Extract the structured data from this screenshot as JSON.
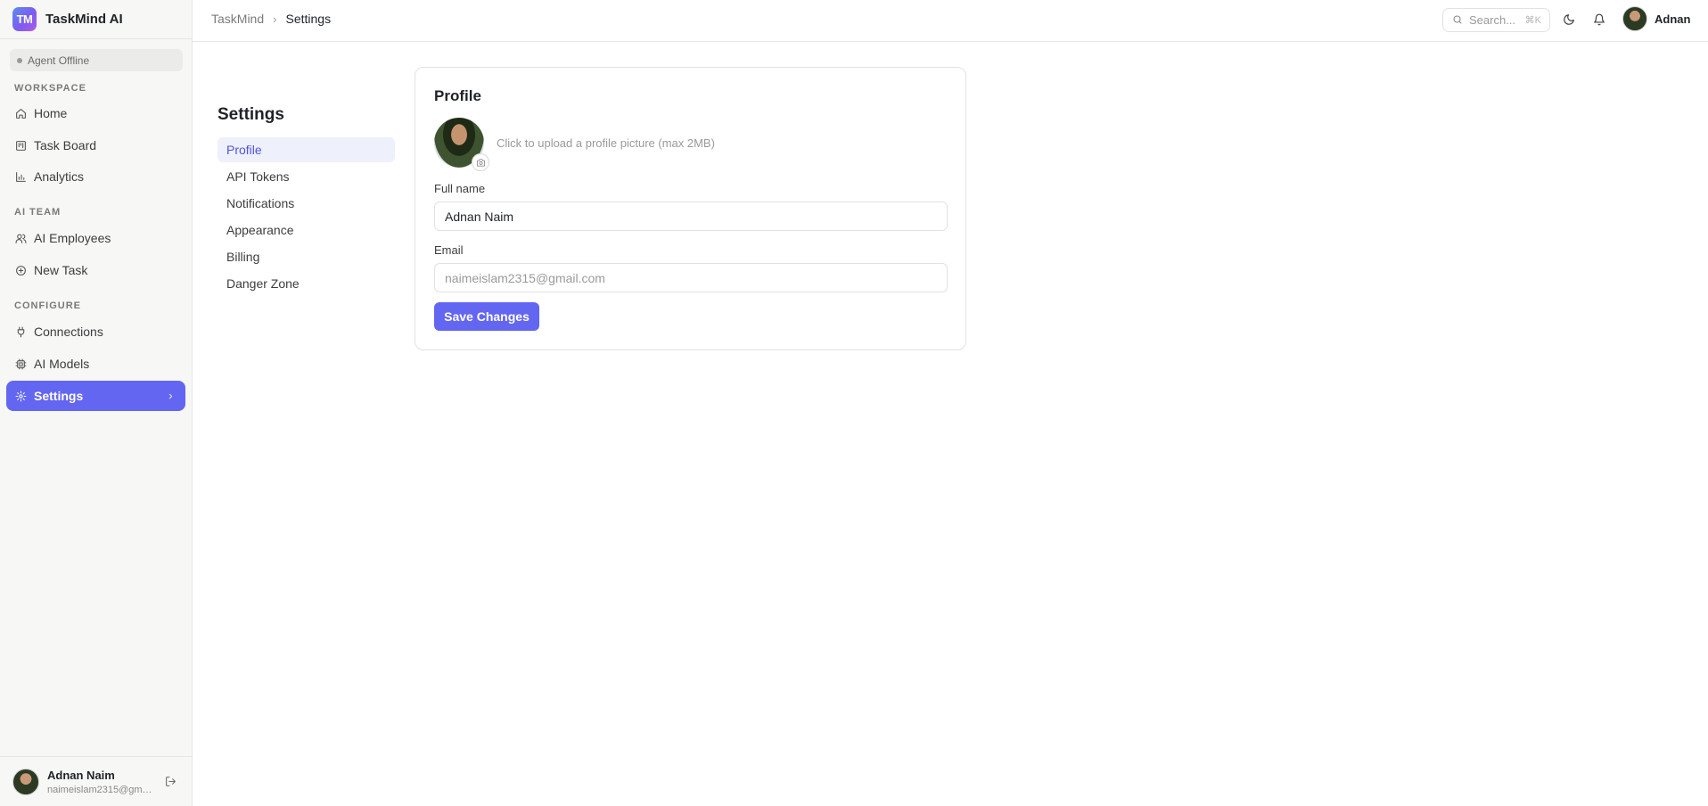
{
  "app": {
    "name": "TaskMind AI",
    "logo_text": "TM",
    "accent_color": "#6366f1"
  },
  "sidebar": {
    "agent_status": "Agent Offline",
    "sections": [
      {
        "label": "WORKSPACE",
        "items": [
          {
            "label": "Home",
            "icon": "home-icon"
          },
          {
            "label": "Task Board",
            "icon": "kanban-icon"
          },
          {
            "label": "Analytics",
            "icon": "bar-chart-icon"
          }
        ]
      },
      {
        "label": "AI TEAM",
        "items": [
          {
            "label": "AI Employees",
            "icon": "users-icon"
          },
          {
            "label": "New Task",
            "icon": "plus-circle-icon"
          }
        ]
      },
      {
        "label": "CONFIGURE",
        "items": [
          {
            "label": "Connections",
            "icon": "plug-icon"
          },
          {
            "label": "AI Models",
            "icon": "cpu-icon"
          },
          {
            "label": "Settings",
            "icon": "gear-icon",
            "active": true
          }
        ]
      }
    ],
    "user": {
      "name": "Adnan Naim",
      "email": "naimeislam2315@gma..."
    }
  },
  "topbar": {
    "breadcrumb_root": "TaskMind",
    "breadcrumb_current": "Settings",
    "search_placeholder": "Search...",
    "search_shortcut": "⌘K",
    "username": "Adnan"
  },
  "settings": {
    "title": "Settings",
    "nav": [
      "Profile",
      "API Tokens",
      "Notifications",
      "Appearance",
      "Billing",
      "Danger Zone"
    ],
    "active_nav": "Profile"
  },
  "profile": {
    "title": "Profile",
    "upload_hint": "Click to upload a profile picture (max 2MB)",
    "full_name_label": "Full name",
    "full_name_value": "Adnan Naim",
    "email_label": "Email",
    "email_value": "naimeislam2315@gmail.com",
    "save_label": "Save Changes"
  }
}
